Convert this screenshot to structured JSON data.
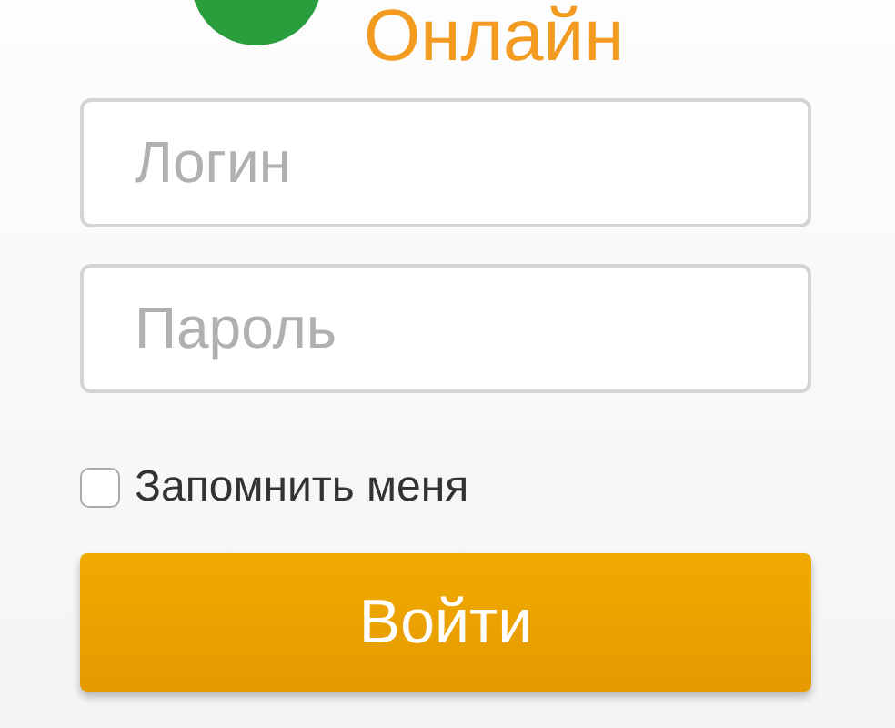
{
  "logo": {
    "text": "Онлайн"
  },
  "login_field": {
    "placeholder": "Логин"
  },
  "password_field": {
    "placeholder": "Пароль"
  },
  "remember": {
    "label": "Запомнить меня",
    "checked": false
  },
  "submit_button": {
    "label": "Войти"
  }
}
